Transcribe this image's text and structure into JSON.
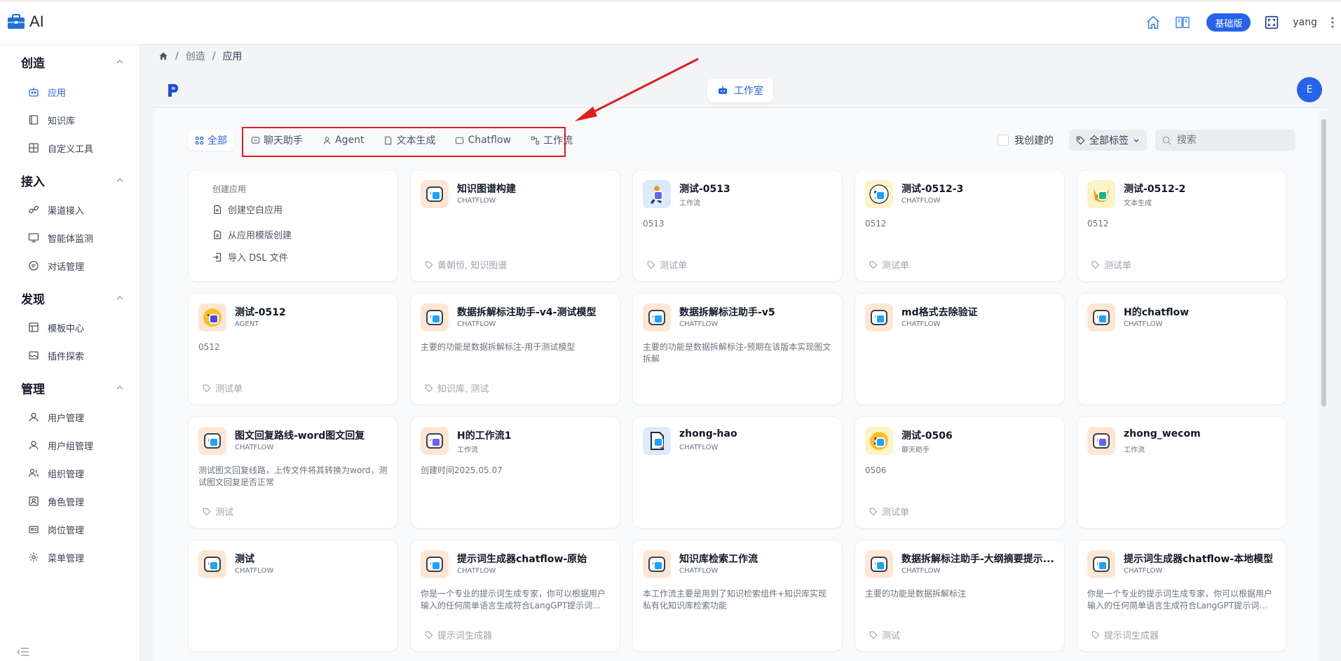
{
  "app": {
    "brand_text": "AI"
  },
  "header": {
    "edition_label": "基础版",
    "username": "yang"
  },
  "sidebar": {
    "groups": [
      {
        "title": "创造",
        "items": [
          {
            "label": "应用",
            "icon": "robot-icon",
            "active": true
          },
          {
            "label": "知识库",
            "icon": "book-icon"
          },
          {
            "label": "自定义工具",
            "icon": "toolbox-icon"
          }
        ]
      },
      {
        "title": "接入",
        "items": [
          {
            "label": "渠道接入",
            "icon": "link-icon"
          },
          {
            "label": "智能体监测",
            "icon": "monitor-icon"
          },
          {
            "label": "对话管理",
            "icon": "chat-icon"
          }
        ]
      },
      {
        "title": "发现",
        "items": [
          {
            "label": "模板中心",
            "icon": "template-icon"
          },
          {
            "label": "插件探索",
            "icon": "plugin-icon"
          }
        ]
      },
      {
        "title": "管理",
        "items": [
          {
            "label": "用户管理",
            "icon": "user-icon"
          },
          {
            "label": "用户组管理",
            "icon": "user-group-icon"
          },
          {
            "label": "组织管理",
            "icon": "org-icon"
          },
          {
            "label": "角色管理",
            "icon": "role-icon"
          },
          {
            "label": "岗位管理",
            "icon": "post-icon"
          },
          {
            "label": "菜单管理",
            "icon": "menu-gear-icon"
          }
        ]
      }
    ]
  },
  "breadcrumb": {
    "items": [
      "创造",
      "应用"
    ]
  },
  "studio": {
    "tab_label": "工作室",
    "avatar_letter": "E"
  },
  "filters": {
    "tabs": [
      "全部",
      "聊天助手",
      "Agent",
      "文本生成",
      "Chatflow",
      "工作流"
    ],
    "mine_label": "我创建的",
    "tags_label": "全部标签",
    "search_placeholder": "搜索"
  },
  "create_card": {
    "title": "创建应用",
    "options": [
      "创建空白应用",
      "从应用模版创建",
      "导入 DSL 文件"
    ]
  },
  "apps": [
    {
      "name": "知识图谱构建",
      "type": "CHATFLOW",
      "desc": "",
      "tags": "黄朝恒, 知识图谱"
    },
    {
      "name": "测试-0513",
      "type": "工作流",
      "desc": "0513",
      "tags": "测试单"
    },
    {
      "name": "测试-0512-3",
      "type": "CHATFLOW",
      "desc": "0512",
      "tags": "测试单"
    },
    {
      "name": "测试-0512-2",
      "type": "文本生成",
      "desc": "0512",
      "tags": "测试单"
    },
    {
      "name": "测试-0512",
      "type": "AGENT",
      "desc": "0512",
      "tags": "测试单"
    },
    {
      "name": "数据拆解标注助手-v4-测试模型",
      "type": "CHATFLOW",
      "desc": "主要的功能是数据拆解标注-用于测试模型",
      "tags": "知识库, 测试"
    },
    {
      "name": "数据拆解标注助手-v5",
      "type": "CHATFLOW",
      "desc": "主要的功能是数据拆解标注-预期在该版本实现图文拆解",
      "tags": ""
    },
    {
      "name": "md格式去除验证",
      "type": "CHATFLOW",
      "desc": "",
      "tags": ""
    },
    {
      "name": "H的chatflow",
      "type": "CHATFLOW",
      "desc": "",
      "tags": ""
    },
    {
      "name": "图文回复路线-word图文回复",
      "type": "CHATFLOW",
      "desc": "测试图文回复线路，上传文件将其转换为word，测试图文回复是否正常",
      "tags": "测试"
    },
    {
      "name": "H的工作流1",
      "type": "工作流",
      "desc": "创建时间2025.05.07",
      "tags": ""
    },
    {
      "name": "zhong-hao",
      "type": "CHATFLOW",
      "desc": "",
      "tags": ""
    },
    {
      "name": "测试-0506",
      "type": "聊天助手",
      "desc": "0506",
      "tags": "测试单"
    },
    {
      "name": "zhong_wecom",
      "type": "工作流",
      "desc": "",
      "tags": ""
    },
    {
      "name": "测试",
      "type": "CHATFLOW",
      "desc": "",
      "tags": ""
    },
    {
      "name": "提示词生成器chatflow-原始",
      "type": "CHATFLOW",
      "desc": "你是一个专业的提示词生成专家，你可以根据用户输入的任何简单语言生成符合LangGPT提示词...",
      "tags": "提示词生成器"
    },
    {
      "name": "知识库检索工作流",
      "type": "CHATFLOW",
      "desc": "本工作流主要是用到了知识检索组件+知识库实现私有化知识库检索功能",
      "tags": ""
    },
    {
      "name": "数据拆解标注助手-大纲摘要提示...",
      "type": "CHATFLOW",
      "desc": "主要的功能是数据拆解标注",
      "tags": "测试"
    },
    {
      "name": "提示词生成器chatflow-本地模型",
      "type": "CHATFLOW",
      "desc": "你是一个专业的提示词生成专家，你可以根据用户输入的任何简单语言生成符合LangGPT提示词...",
      "tags": "提示词生成器"
    }
  ],
  "colors": {
    "accent": "#2563eb",
    "annotation_red": "#e11d1d"
  }
}
